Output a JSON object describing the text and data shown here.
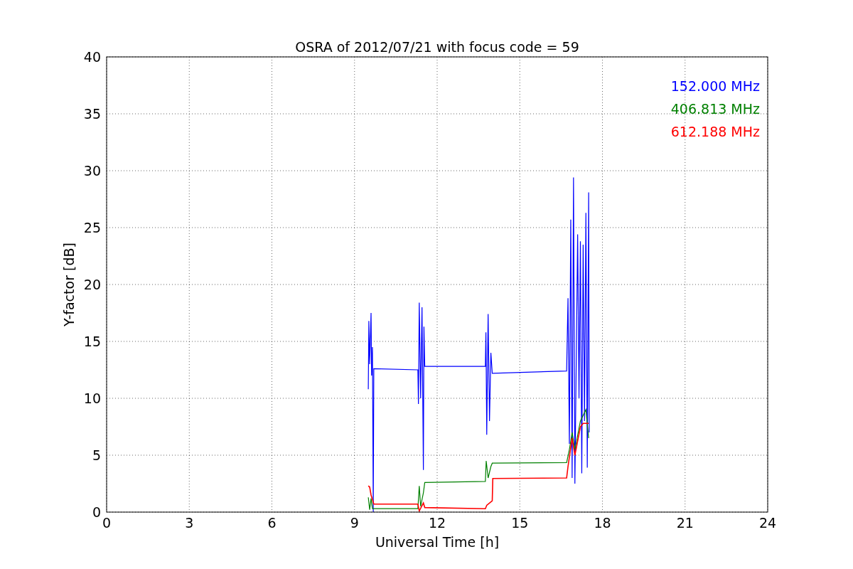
{
  "figure": {
    "chart_data": {
      "type": "line",
      "grid": true,
      "title": "OSRA of 2012/07/21 with focus code = 59",
      "xlabel": "Universal Time [h]",
      "ylabel": "Y-factor [dB]",
      "xlim": [
        0,
        24
      ],
      "ylim": [
        0,
        40
      ],
      "xticks": [
        0,
        3,
        6,
        9,
        12,
        15,
        18,
        21,
        24
      ],
      "yticks": [
        0,
        5,
        10,
        15,
        20,
        25,
        30,
        35,
        40
      ],
      "series": [
        {
          "name": "152.000 MHz",
          "color": "#0000ff",
          "x": [
            9.5,
            9.52,
            9.55,
            9.6,
            9.62,
            9.65,
            9.68,
            9.7,
            11.3,
            11.32,
            11.35,
            11.4,
            11.45,
            11.5,
            11.52,
            11.55,
            13.75,
            13.77,
            13.8,
            13.85,
            13.9,
            13.95,
            14.0,
            16.7,
            16.75,
            16.8,
            16.85,
            16.9,
            16.95,
            17.0,
            17.1,
            17.15,
            17.2,
            17.25,
            17.3,
            17.35,
            17.4,
            17.45,
            17.5,
            17.52
          ],
          "values": [
            10.8,
            16.8,
            13,
            17.5,
            12,
            14.5,
            0,
            12.6,
            12.5,
            9.5,
            18.4,
            10,
            18,
            3.7,
            16.3,
            12.8,
            12.8,
            15.8,
            6.8,
            17.4,
            8,
            14,
            12.2,
            12.4,
            18.8,
            6,
            25.7,
            3,
            29.4,
            2.5,
            24.4,
            10,
            23.8,
            3.4,
            23.5,
            8,
            26.3,
            3.9,
            28.1,
            7
          ]
        },
        {
          "name": "406.813 MHz",
          "color": "#008000",
          "x": [
            9.5,
            9.55,
            9.6,
            9.65,
            11.3,
            11.35,
            11.4,
            11.5,
            11.55,
            13.75,
            13.78,
            13.85,
            13.95,
            14.0,
            16.7,
            16.8,
            16.9,
            17.0,
            17.2,
            17.4,
            17.5
          ],
          "values": [
            1.3,
            0.2,
            1.2,
            0.3,
            0.3,
            2.3,
            0.5,
            1.7,
            2.6,
            2.7,
            4.5,
            3,
            4,
            4.3,
            4.35,
            5.5,
            7,
            5.5,
            8,
            9,
            6.5
          ]
        },
        {
          "name": "612.188 MHz",
          "color": "#ff0000",
          "x": [
            9.5,
            9.55,
            9.6,
            9.7,
            11.3,
            11.35,
            11.5,
            11.55,
            13.75,
            13.8,
            14.0,
            14.02,
            16.7,
            16.75,
            16.9,
            17.0,
            17.2,
            17.3,
            17.5
          ],
          "values": [
            2.3,
            2.2,
            1.5,
            0.7,
            0.7,
            0.1,
            0.8,
            0.4,
            0.3,
            0.6,
            1.0,
            2.95,
            3.0,
            4.0,
            6.5,
            5,
            7.5,
            7.8,
            7.8
          ]
        }
      ]
    }
  }
}
